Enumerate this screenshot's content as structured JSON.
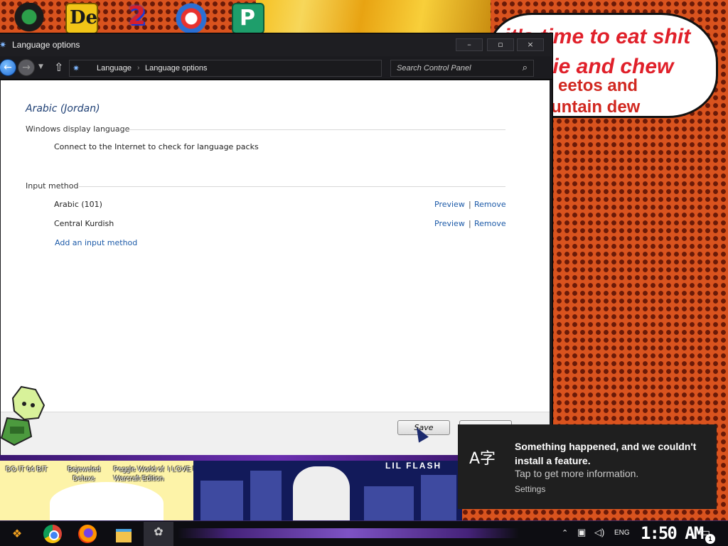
{
  "window": {
    "title": "Language options",
    "controls": {
      "minimize": "–",
      "maximize": "▫",
      "close": "×"
    }
  },
  "address_bar": {
    "breadcrumb": [
      "Language",
      "Language options"
    ],
    "separator": "›",
    "search_placeholder": "Search Control Panel"
  },
  "page": {
    "heading": "Arabic (Jordan)",
    "display_language": {
      "label": "Windows display language",
      "text": "Connect to the Internet to check for language packs"
    },
    "input_method": {
      "label": "Input method",
      "items": [
        {
          "name": "Arabic (101)",
          "preview": "Preview",
          "remove": "Remove"
        },
        {
          "name": "Central Kurdish",
          "preview": "Preview",
          "remove": "Remove"
        }
      ],
      "add_link": "Add an input method"
    },
    "footer": {
      "save": "Save"
    }
  },
  "desktop": {
    "bubble_text": [
      "it's time to eat shit",
      "die and chew",
      "eetos and",
      "untain dew"
    ],
    "icons": [
      "DO IT 64 BIT",
      "Bejeweled Deluxe",
      "Peggle World of Warcraft Edition",
      "I LOVE EMOTET"
    ],
    "icon_glyphs": {
      "deluxe": "De",
      "two": "2",
      "project": "P"
    },
    "poster_title": "LIL FLASH"
  },
  "notification": {
    "icon": "A字",
    "title": "Something happened, and we couldn't install a feature.",
    "body": "Tap to get more information.",
    "source": "Settings"
  },
  "taskbar": {
    "language": "ENG",
    "time": "1:50 AM",
    "notification_count": "1"
  },
  "colors": {
    "link": "#1c5aa8",
    "heading": "#1e3f74",
    "toast_bg": "#1f1f1f",
    "desktop_orange": "#d9531e"
  }
}
